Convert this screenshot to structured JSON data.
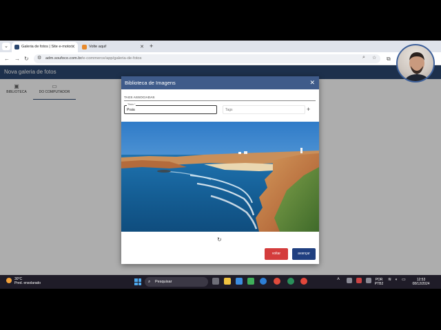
{
  "browser": {
    "tabs": [
      {
        "title": "Galeria de fotos | Site e-motor",
        "active": true
      },
      {
        "title": "Volte aqui!",
        "active": false
      }
    ],
    "url_host": "adm.soufoco.com.br",
    "url_path": "/e-commerce/app/galeria-de-fotos"
  },
  "app": {
    "title": "Nova galeria de fotos",
    "tabs": [
      {
        "label": "BIBLIOTECA",
        "icon": "image-icon"
      },
      {
        "label": "DO COMPUTADOR",
        "icon": "monitor-icon"
      }
    ],
    "background_button": "voltar"
  },
  "dialog": {
    "title": "Biblioteca de Imagens",
    "tags_section": "TAGS ASSOCIADAS",
    "title_field_label": "Título *",
    "title_field_value": "Praia",
    "tags_placeholder": "Tags",
    "voltar_label": "voltar",
    "avancar_label": "avançar"
  },
  "taskbar": {
    "temperature": "30°C",
    "weather_text": "Pred. ensolarado",
    "search_label": "Pesquisar",
    "lang_top": "POR",
    "lang_bottom": "PTB2",
    "time": "12:53",
    "date": "08/12/2024"
  },
  "colors": {
    "header": "#2b4770",
    "dialog_header": "#3f5b8a",
    "voltar": "#d43c3c",
    "avancar": "#1f3f80"
  }
}
